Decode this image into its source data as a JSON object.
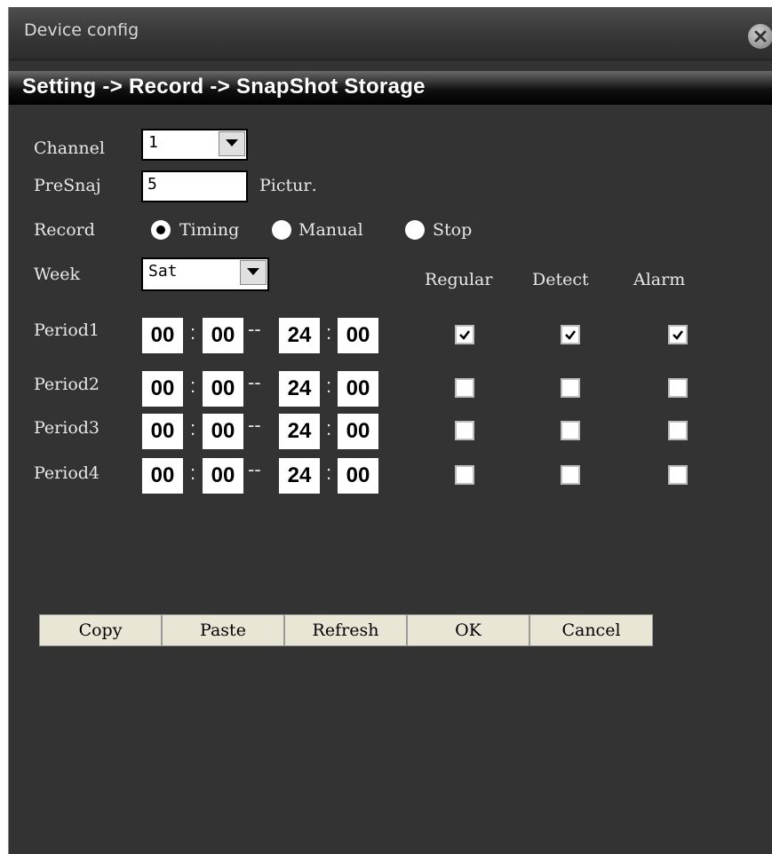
{
  "window": {
    "title": "Device config",
    "close_icon": "close-icon"
  },
  "breadcrumb": "Setting -> Record -> SnapShot Storage",
  "channel": {
    "label": "Channel",
    "value": "1"
  },
  "presnap": {
    "label": "PreSnaj",
    "value": "5",
    "unit": "Pictur․"
  },
  "record": {
    "label": "Record",
    "options": [
      {
        "label": "Timing",
        "selected": true
      },
      {
        "label": "Manual",
        "selected": false
      },
      {
        "label": "Stop",
        "selected": false
      }
    ]
  },
  "week": {
    "label": "Week",
    "value": "Sat"
  },
  "columns": [
    "Regular",
    "Detect",
    "Alarm"
  ],
  "periods": [
    {
      "label": "Period1",
      "start_h": "00",
      "start_m": "00",
      "end_h": "24",
      "end_m": "00",
      "regular": true,
      "detect": true,
      "alarm": true
    },
    {
      "label": "Period2",
      "start_h": "00",
      "start_m": "00",
      "end_h": "24",
      "end_m": "00",
      "regular": false,
      "detect": false,
      "alarm": false
    },
    {
      "label": "Period3",
      "start_h": "00",
      "start_m": "00",
      "end_h": "24",
      "end_m": "00",
      "regular": false,
      "detect": false,
      "alarm": false
    },
    {
      "label": "Period4",
      "start_h": "00",
      "start_m": "00",
      "end_h": "24",
      "end_m": "00",
      "regular": false,
      "detect": false,
      "alarm": false
    }
  ],
  "buttons": {
    "copy": "Copy",
    "paste": "Paste",
    "refresh": "Refresh",
    "ok": "OK",
    "cancel": "Cancel"
  },
  "colors": {
    "background": "#333333",
    "text": "#e8e8e8",
    "button_face": "#eae6d6"
  }
}
